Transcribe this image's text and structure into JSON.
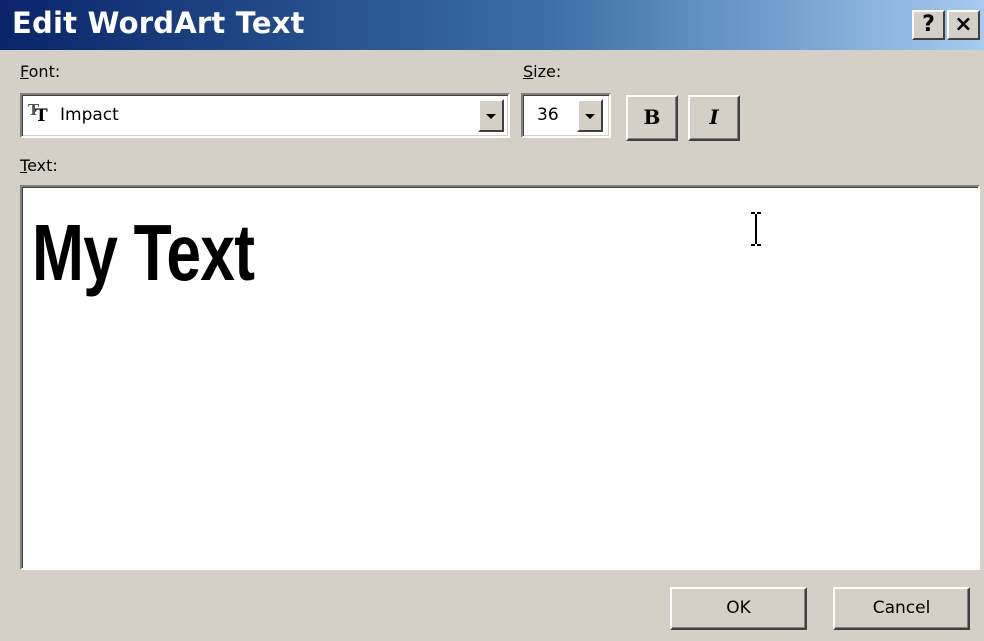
{
  "window": {
    "title": "Edit WordArt Text",
    "help_label": "?",
    "close_label": "×"
  },
  "font": {
    "label_underlined": "F",
    "label_rest": "ont:",
    "value": "Impact",
    "icon": "truetype-font-icon"
  },
  "size": {
    "label_underlined": "S",
    "label_rest": "ize:",
    "value": "36"
  },
  "style_buttons": {
    "bold_label": "B",
    "italic_label": "I"
  },
  "text": {
    "label_underlined": "T",
    "label_rest": "ext:",
    "value": "My Text"
  },
  "buttons": {
    "ok_label": "OK",
    "cancel_label": "Cancel"
  },
  "colors": {
    "title_gradient_start": "#0a246a",
    "title_gradient_end": "#a6caf0",
    "dialog_face": "#d4d0c8"
  }
}
